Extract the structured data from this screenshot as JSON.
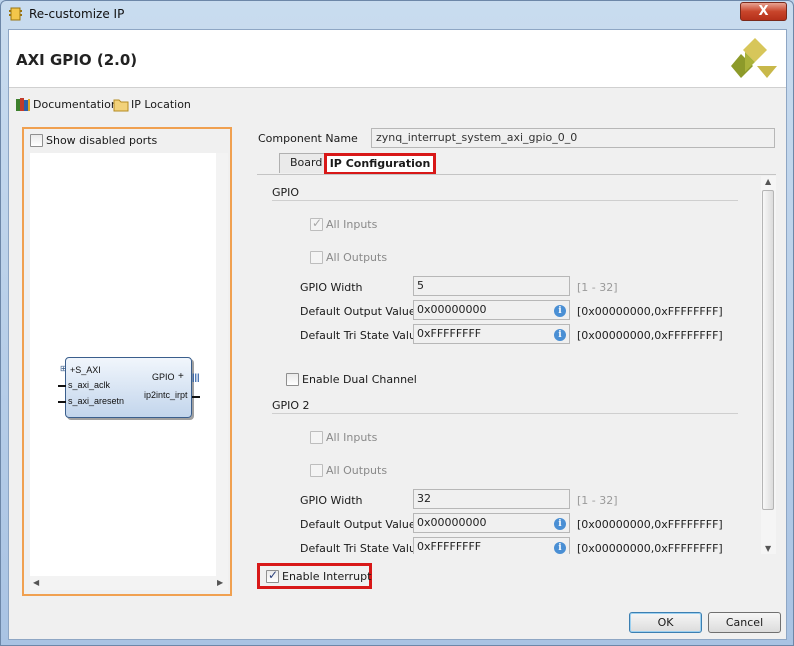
{
  "window": {
    "title": "Re-customize IP",
    "close_label": "X"
  },
  "ip": {
    "title": "AXI GPIO (2.0)"
  },
  "links": {
    "documentation": "Documentation",
    "ip_location": "IP Location"
  },
  "left_panel": {
    "show_disabled_ports": "Show disabled ports",
    "show_disabled_ports_checked": false,
    "block": {
      "port_s_axi": "S_AXI",
      "port_s_axi_aclk": "s_axi_aclk",
      "port_s_axi_aresetn": "s_axi_aresetn",
      "port_gpio": "GPIO",
      "port_ip2intc_irpt": "ip2intc_irpt"
    }
  },
  "component": {
    "label": "Component Name",
    "value": "zynq_interrupt_system_axi_gpio_0_0"
  },
  "tabs": {
    "board": "Board",
    "ip_configuration": "IP Configuration"
  },
  "gpio": {
    "title": "GPIO",
    "all_inputs": "All Inputs",
    "all_inputs_checked": true,
    "all_outputs": "All Outputs",
    "all_outputs_checked": false,
    "width_label": "GPIO Width",
    "width_value": "5",
    "width_range": "[1 - 32]",
    "default_output_label": "Default Output Value",
    "default_output_value": "0x00000000",
    "default_output_range": "[0x00000000,0xFFFFFFFF]",
    "default_tri_label": "Default Tri State Value",
    "default_tri_value": "0xFFFFFFFF",
    "default_tri_range": "[0x00000000,0xFFFFFFFF]"
  },
  "dual_channel": {
    "label": "Enable Dual Channel",
    "checked": false
  },
  "gpio2": {
    "title": "GPIO 2",
    "all_inputs": "All Inputs",
    "all_inputs_checked": false,
    "all_outputs": "All Outputs",
    "all_outputs_checked": false,
    "width_label": "GPIO Width",
    "width_value": "32",
    "width_range": "[1 - 32]",
    "default_output_label": "Default Output Value",
    "default_output_value": "0x00000000",
    "default_output_range": "[0x00000000,0xFFFFFFFF]",
    "default_tri_label": "Default Tri State Value",
    "default_tri_value": "0xFFFFFFFF",
    "default_tri_range": "[0x00000000,0xFFFFFFFF]"
  },
  "interrupt": {
    "label": "Enable Interrupt",
    "checked": true
  },
  "buttons": {
    "ok": "OK",
    "cancel": "Cancel"
  },
  "colors": {
    "highlight": "#d81818",
    "panel_border": "#f0a050",
    "block_border": "#3a5e8c"
  }
}
